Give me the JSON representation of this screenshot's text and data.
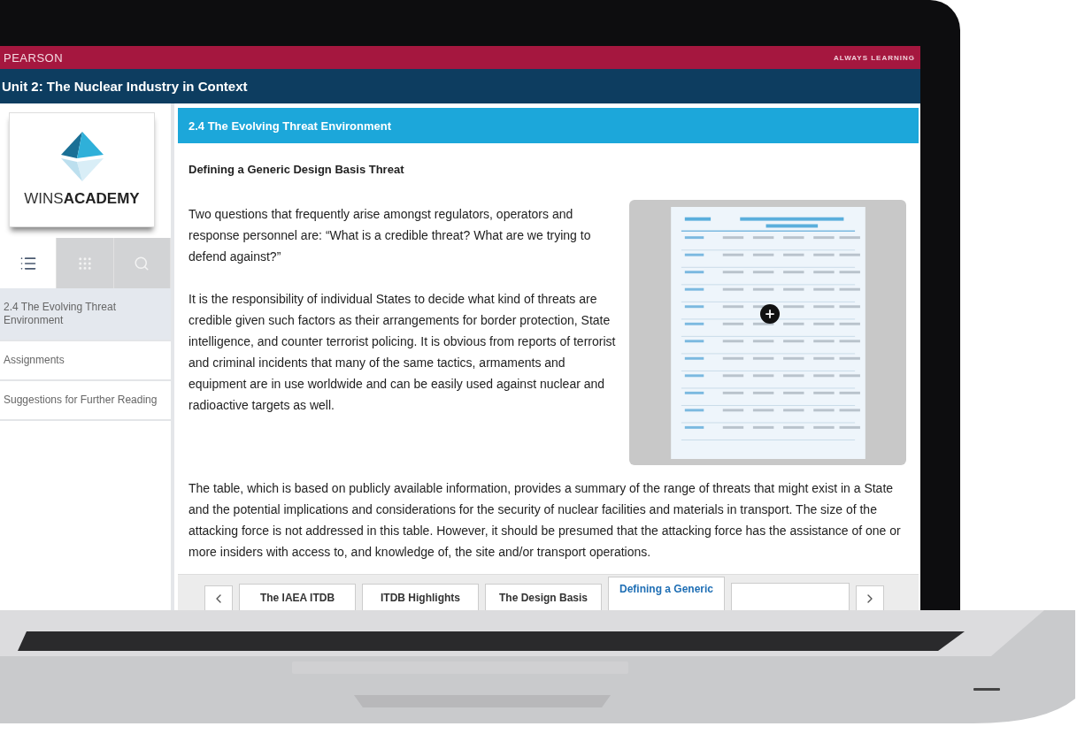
{
  "brand": "PEARSON",
  "tagline": "ALWAYS LEARNING",
  "unit_title": "Unit 2: The Nuclear Industry in Context",
  "logo": {
    "text": "WINS**ACADEMY**"
  },
  "sidebar": {
    "view_tabs": [
      {
        "kind": "list",
        "selected": true
      },
      {
        "kind": "grid",
        "selected": false
      },
      {
        "kind": "search",
        "selected": false
      }
    ],
    "items": [
      {
        "label": "2.4 The Evolving Threat Environment",
        "selected": true
      },
      {
        "label": "Assignments",
        "selected": false
      },
      {
        "label": "Suggestions for Further Reading",
        "selected": false
      }
    ]
  },
  "section": {
    "title": "2.4 The Evolving Threat Environment",
    "heading": "Defining a Generic Design Basis Threat",
    "paragraphs": [
      "Two questions that frequently arise amongst regulators, operators and response personnel are: “What is a credible threat? What are we trying to defend against?”",
      "It is the responsibility of individual States to decide what kind of threats are credible given such factors as their arrangements for border protection, State intelligence, and counter terrorist policing. It is obvious from reports of terrorist and criminal incidents that many of the same tactics, armaments and equipment are in use worldwide and can be easily used against nuclear and radioactive targets as well.",
      "The table, which is based on publicly available information, provides a summary of the range of threats that might exist in a State and the potential implications and considerations for the security of nuclear facilities and materials in transport. The size of the attacking force is not addressed in this table. However, it should be presumed that the attacking force has the assistance of one or more insiders with access to, and knowledge of, the site and/or transport operations."
    ]
  },
  "page_tabs": [
    {
      "label": "The IAEA ITDB",
      "selected": false
    },
    {
      "label": "ITDB Highlights",
      "selected": false
    },
    {
      "label": "The Design Basis",
      "selected": false
    },
    {
      "label": "Defining a Generic",
      "selected": true
    }
  ]
}
